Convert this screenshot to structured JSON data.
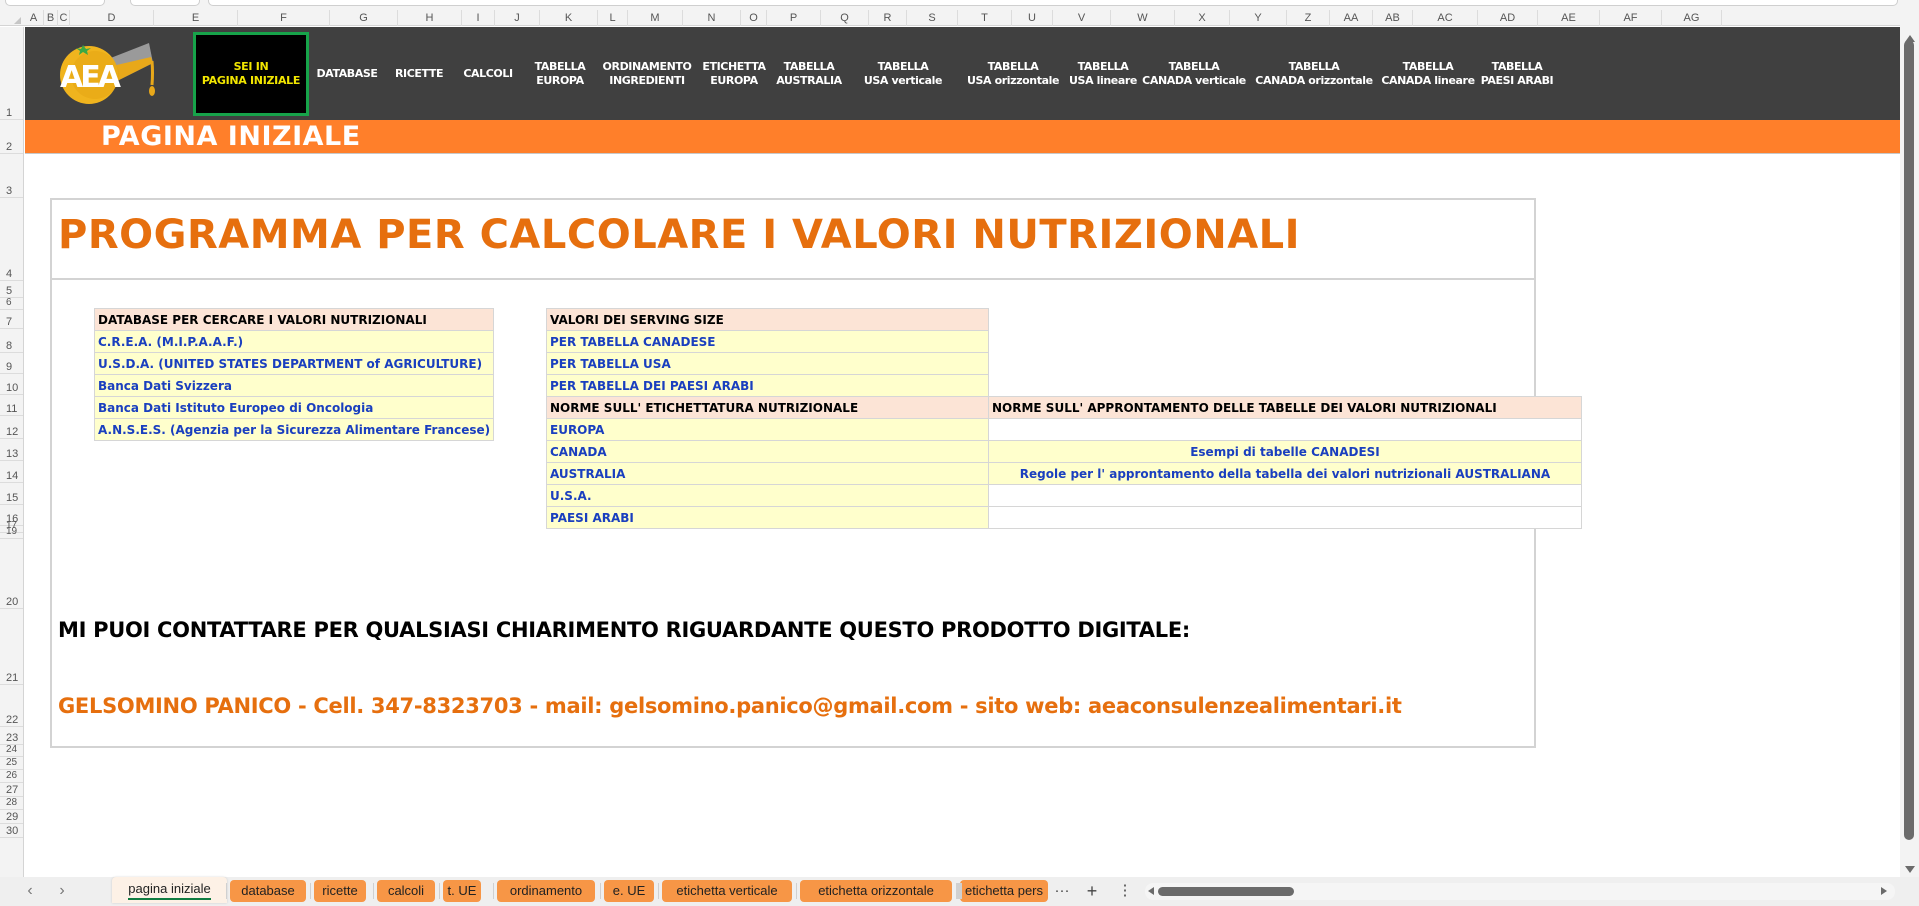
{
  "columns": [
    "A",
    "B",
    "C",
    "D",
    "E",
    "F",
    "G",
    "H",
    "I",
    "J",
    "K",
    "L",
    "M",
    "N",
    "O",
    "P",
    "Q",
    "R",
    "S",
    "T",
    "U",
    "V",
    "W",
    "X",
    "Y",
    "Z",
    "AA",
    "AB",
    "AC",
    "AD",
    "AE",
    "AF",
    "AG"
  ],
  "rows": [
    "1",
    "2",
    "3",
    "4",
    "5",
    "6",
    "7",
    "8",
    "9",
    "10",
    "11",
    "12",
    "13",
    "14",
    "15",
    "16",
    "17",
    "19",
    "20",
    "21",
    "22",
    "23",
    "24",
    "25",
    "26",
    "27",
    "28",
    "29",
    "30"
  ],
  "nav": {
    "logo_text": "AEA",
    "current_line1": "SEI IN",
    "current_line2": "PAGINA INIZIALE",
    "items": [
      {
        "l1": "DATABASE",
        "l2": ""
      },
      {
        "l1": "RICETTE",
        "l2": ""
      },
      {
        "l1": "CALCOLI",
        "l2": ""
      },
      {
        "l1": "TABELLA",
        "l2": "EUROPA"
      },
      {
        "l1": "ORDINAMENTO",
        "l2": "INGREDIENTI"
      },
      {
        "l1": "ETICHETTA",
        "l2": "EUROPA"
      },
      {
        "l1": "TABELLA",
        "l2": "AUSTRALIA"
      },
      {
        "l1": "TABELLA",
        "l2": "USA verticale"
      },
      {
        "l1": "TABELLA",
        "l2": "USA orizzontale"
      },
      {
        "l1": "TABELLA",
        "l2": "USA lineare"
      },
      {
        "l1": "TABELLA",
        "l2": "CANADA verticale"
      },
      {
        "l1": "TABELLA",
        "l2": "CANADA orizzontale"
      },
      {
        "l1": "TABELLA",
        "l2": "CANADA lineare"
      },
      {
        "l1": "TABELLA",
        "l2": "PAESI ARABI"
      }
    ]
  },
  "page_title": "PAGINA INIZIALE",
  "main_title": "PROGRAMMA PER CALCOLARE I VALORI NUTRIZIONALI",
  "database_table": {
    "header": "DATABASE  PER CERCARE I VALORI NUTRIZIONALI",
    "items": [
      "C.R.E.A. (M.I.P.A.A.F.)",
      "U.S.D.A. (UNITED STATES DEPARTMENT of AGRICULTURE)",
      "Banca Dati Svizzera",
      "Banca Dati Istituto Europeo di Oncologia",
      "A.N.S.E.S. (Agenzia per la Sicurezza Alimentare Francese)"
    ]
  },
  "serving_table": {
    "header": "VALORI DEI SERVING SIZE",
    "items": [
      "PER TABELLA CANADESE",
      "PER TABELLA USA",
      "PER TABELLA DEI PAESI ARABI"
    ]
  },
  "norme_table": {
    "header_left": "NORME SULL' ETICHETTATURA NUTRIZIONALE",
    "header_right": "NORME SULL' APPRONTAMENTO DELLE TABELLE DEI VALORI NUTRIZIONALI",
    "rows": [
      {
        "left": "EUROPA",
        "right": ""
      },
      {
        "left": "CANADA",
        "right": "Esempi di tabelle CANADESI"
      },
      {
        "left": "AUSTRALIA",
        "right": "Regole per l' approntamento della tabella dei valori nutrizionali AUSTRALIANA"
      },
      {
        "left": "U.S.A.",
        "right": ""
      },
      {
        "left": "PAESI ARABI",
        "right": ""
      }
    ]
  },
  "contact": {
    "question": "MI PUOI CONTATTARE PER QUALSIASI CHIARIMENTO RIGUARDANTE QUESTO PRODOTTO DIGITALE:",
    "info": "GELSOMINO PANICO - Cell. 347-8323703 - mail: gelsomino.panico@gmail.com - sito web: aeaconsulenzealimentari.it"
  },
  "sheet_tabs": [
    {
      "label": "pagina iniziale",
      "active": true
    },
    {
      "label": "database"
    },
    {
      "label": "ricette"
    },
    {
      "label": "calcoli"
    },
    {
      "label": "t. UE"
    },
    {
      "label": "ordinamento"
    },
    {
      "label": "e. UE"
    },
    {
      "label": "etichetta verticale"
    },
    {
      "label": "etichetta orizzontale"
    },
    {
      "label": "etichetta pers"
    }
  ],
  "tabbar": {
    "prev": "‹",
    "next": "›",
    "more": "···",
    "add": "+",
    "options": "⋮"
  },
  "colors": {
    "navbar": "#404040",
    "accent_orange": "#ff7f2a",
    "title_orange": "#e66f0e",
    "current_border": "#17a34a",
    "current_text": "#f2e600",
    "link_blue": "#1a3fbf",
    "header_fill": "#fce4d6",
    "link_fill": "#ffffcc",
    "tab_orange": "#f79646"
  }
}
